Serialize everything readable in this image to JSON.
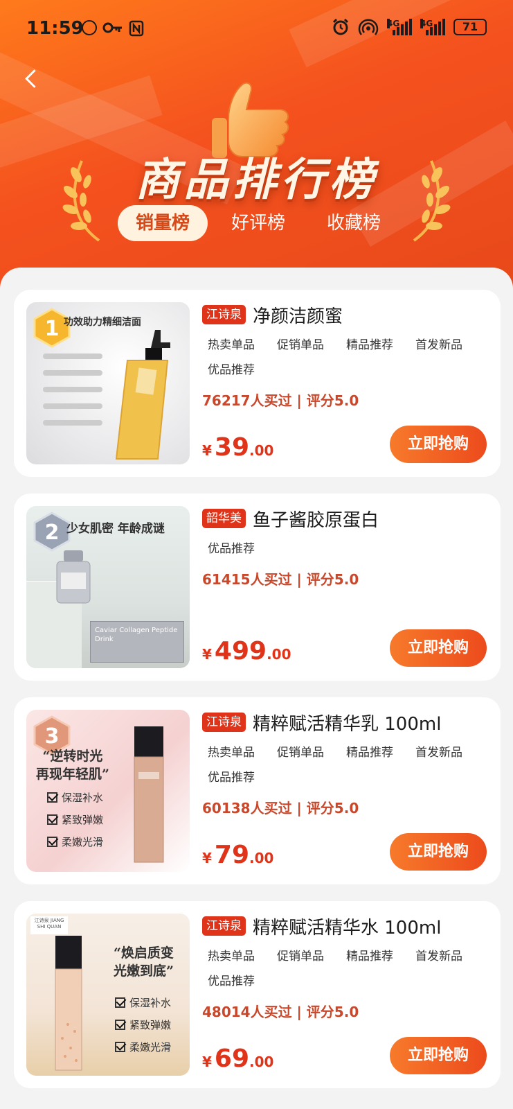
{
  "status_bar": {
    "time": "11:59",
    "battery": "71",
    "signal_1_label": "4G",
    "signal_2_label": "4G"
  },
  "header": {
    "title": "商品排行榜",
    "tabs": [
      {
        "label": "销量榜",
        "active": true
      },
      {
        "label": "好评榜",
        "active": false
      },
      {
        "label": "收藏榜",
        "active": false
      }
    ]
  },
  "products": [
    {
      "rank": "1",
      "brand": "江诗泉",
      "name": "净颜洁颜蜜",
      "tags": [
        "热卖单品",
        "促销单品",
        "精品推荐",
        "首发新品",
        "优品推荐"
      ],
      "stats": "76217人买过 | 评分5.0",
      "currency": "¥",
      "price_int": "39",
      "price_dec": ".00",
      "button": "立即抢购",
      "image_headline": "功效助力精细洁面",
      "image_colors": {
        "bg": "#e8e8ea",
        "bottle": "#f0c34a"
      }
    },
    {
      "rank": "2",
      "brand": "韶华美",
      "name": "鱼子酱胶原蛋白",
      "tags": [
        "优品推荐"
      ],
      "stats": "61415人买过 | 评分5.0",
      "currency": "¥",
      "price_int": "499",
      "price_dec": ".00",
      "button": "立即抢购",
      "image_headline": "少女肌密 年龄成谜",
      "image_box_text": "Caviar Collagen Peptide Drink",
      "image_colors": {
        "bg": "#dfe6e3",
        "bottle": "#b9b9c0"
      }
    },
    {
      "rank": "3",
      "brand": "江诗泉",
      "name": "精粹赋活精华乳 100ml",
      "tags": [
        "热卖单品",
        "促销单品",
        "精品推荐",
        "首发新品",
        "优品推荐"
      ],
      "stats": "60138人买过 | 评分5.0",
      "currency": "¥",
      "price_int": "79",
      "price_dec": ".00",
      "button": "立即抢购",
      "image_headline": "“逆转时光\n再现年轻肌”",
      "image_checks": [
        "保湿补水",
        "紧致弹嫩",
        "柔嫩光滑"
      ],
      "image_colors": {
        "bg": "#f6dada",
        "bottle": "#d4a48c"
      }
    },
    {
      "rank": "",
      "brand": "江诗泉",
      "name": "精粹赋活精华水 100ml",
      "tags": [
        "热卖单品",
        "促销单品",
        "精品推荐",
        "首发新品",
        "优品推荐"
      ],
      "stats": "48014人买过 | 评分5.0",
      "currency": "¥",
      "price_int": "69",
      "price_dec": ".00",
      "button": "立即抢购",
      "image_headline": "“焕启质变\n光嫩到底”",
      "image_checks": [
        "保湿补水",
        "紧致弹嫩",
        "柔嫩光滑"
      ],
      "image_logo": "江诗泉 JIANG SHI QUAN",
      "image_colors": {
        "bg": "#f5ebe2",
        "bottle": "#e6b898"
      }
    }
  ]
}
